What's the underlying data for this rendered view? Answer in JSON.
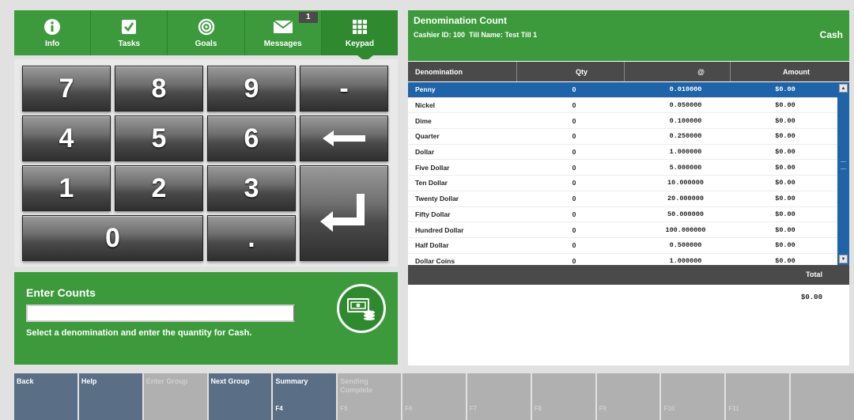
{
  "tabs": {
    "items": [
      {
        "label": "Info",
        "icon": "info-icon"
      },
      {
        "label": "Tasks",
        "icon": "checkbox-icon"
      },
      {
        "label": "Goals",
        "icon": "target-icon"
      },
      {
        "label": "Messages",
        "icon": "envelope-icon",
        "badge": "1"
      },
      {
        "label": "Keypad",
        "icon": "keypad-grid-icon",
        "active": true
      }
    ]
  },
  "keypad": {
    "keys": [
      "7",
      "8",
      "9",
      "-",
      "4",
      "5",
      "6",
      "←",
      "1",
      "2",
      "3",
      "↵",
      "0",
      "."
    ]
  },
  "entry": {
    "title": "Enter Counts",
    "input_value": "",
    "message": "Select a denomination and enter the quantity for Cash."
  },
  "denomination": {
    "title": "Denomination Count",
    "cashier_label": "Cashier ID:",
    "cashier_id": "100",
    "till_label": "Till Name:",
    "till_name": "Test Till 1",
    "tender": "Cash",
    "columns": [
      "Denomination",
      "Qty",
      "@",
      "Amount"
    ],
    "rows": [
      {
        "name": "Penny",
        "qty": "0",
        "at": "0.010000",
        "amount": "$0.00"
      },
      {
        "name": "Nickel",
        "qty": "0",
        "at": "0.050000",
        "amount": "$0.00"
      },
      {
        "name": "Dime",
        "qty": "0",
        "at": "0.100000",
        "amount": "$0.00"
      },
      {
        "name": "Quarter",
        "qty": "0",
        "at": "0.250000",
        "amount": "$0.00"
      },
      {
        "name": "Dollar",
        "qty": "0",
        "at": "1.000000",
        "amount": "$0.00"
      },
      {
        "name": "Five Dollar",
        "qty": "0",
        "at": "5.000000",
        "amount": "$0.00"
      },
      {
        "name": "Ten Dollar",
        "qty": "0",
        "at": "10.000000",
        "amount": "$0.00"
      },
      {
        "name": "Twenty Dollar",
        "qty": "0",
        "at": "20.000000",
        "amount": "$0.00"
      },
      {
        "name": "Fifty Dollar",
        "qty": "0",
        "at": "50.000000",
        "amount": "$0.00"
      },
      {
        "name": "Hundred Dollar",
        "qty": "0",
        "at": "100.000000",
        "amount": "$0.00"
      },
      {
        "name": "Half Dollar",
        "qty": "0",
        "at": "0.500000",
        "amount": "$0.00"
      },
      {
        "name": "Dollar Coins",
        "qty": "0",
        "at": "1.000000",
        "amount": "$0.00"
      }
    ],
    "selected_index": 0,
    "total_label": "Total",
    "total_value": "$0.00"
  },
  "function_keys": [
    {
      "label": "Back",
      "code": "",
      "enabled": true
    },
    {
      "label": "Help",
      "code": "",
      "enabled": true
    },
    {
      "label": "Enter Group",
      "code": "",
      "enabled": false
    },
    {
      "label": "Next Group",
      "code": "",
      "enabled": true
    },
    {
      "label": "Summary",
      "code": "F4",
      "enabled": true
    },
    {
      "label": "Sending Complete",
      "code": "F5",
      "enabled": false
    },
    {
      "label": "",
      "code": "F6",
      "enabled": false
    },
    {
      "label": "",
      "code": "F7",
      "enabled": false
    },
    {
      "label": "",
      "code": "F8",
      "enabled": false
    },
    {
      "label": "",
      "code": "F9",
      "enabled": false
    },
    {
      "label": "",
      "code": "F10",
      "enabled": false
    },
    {
      "label": "",
      "code": "F11",
      "enabled": false
    },
    {
      "label": "",
      "code": "",
      "enabled": false
    }
  ],
  "colors": {
    "brand_green": "#3c9a3c",
    "selected_blue": "#1f63a8",
    "fkey_enabled": "#5a6f86",
    "fkey_disabled": "#b0b0b0"
  }
}
